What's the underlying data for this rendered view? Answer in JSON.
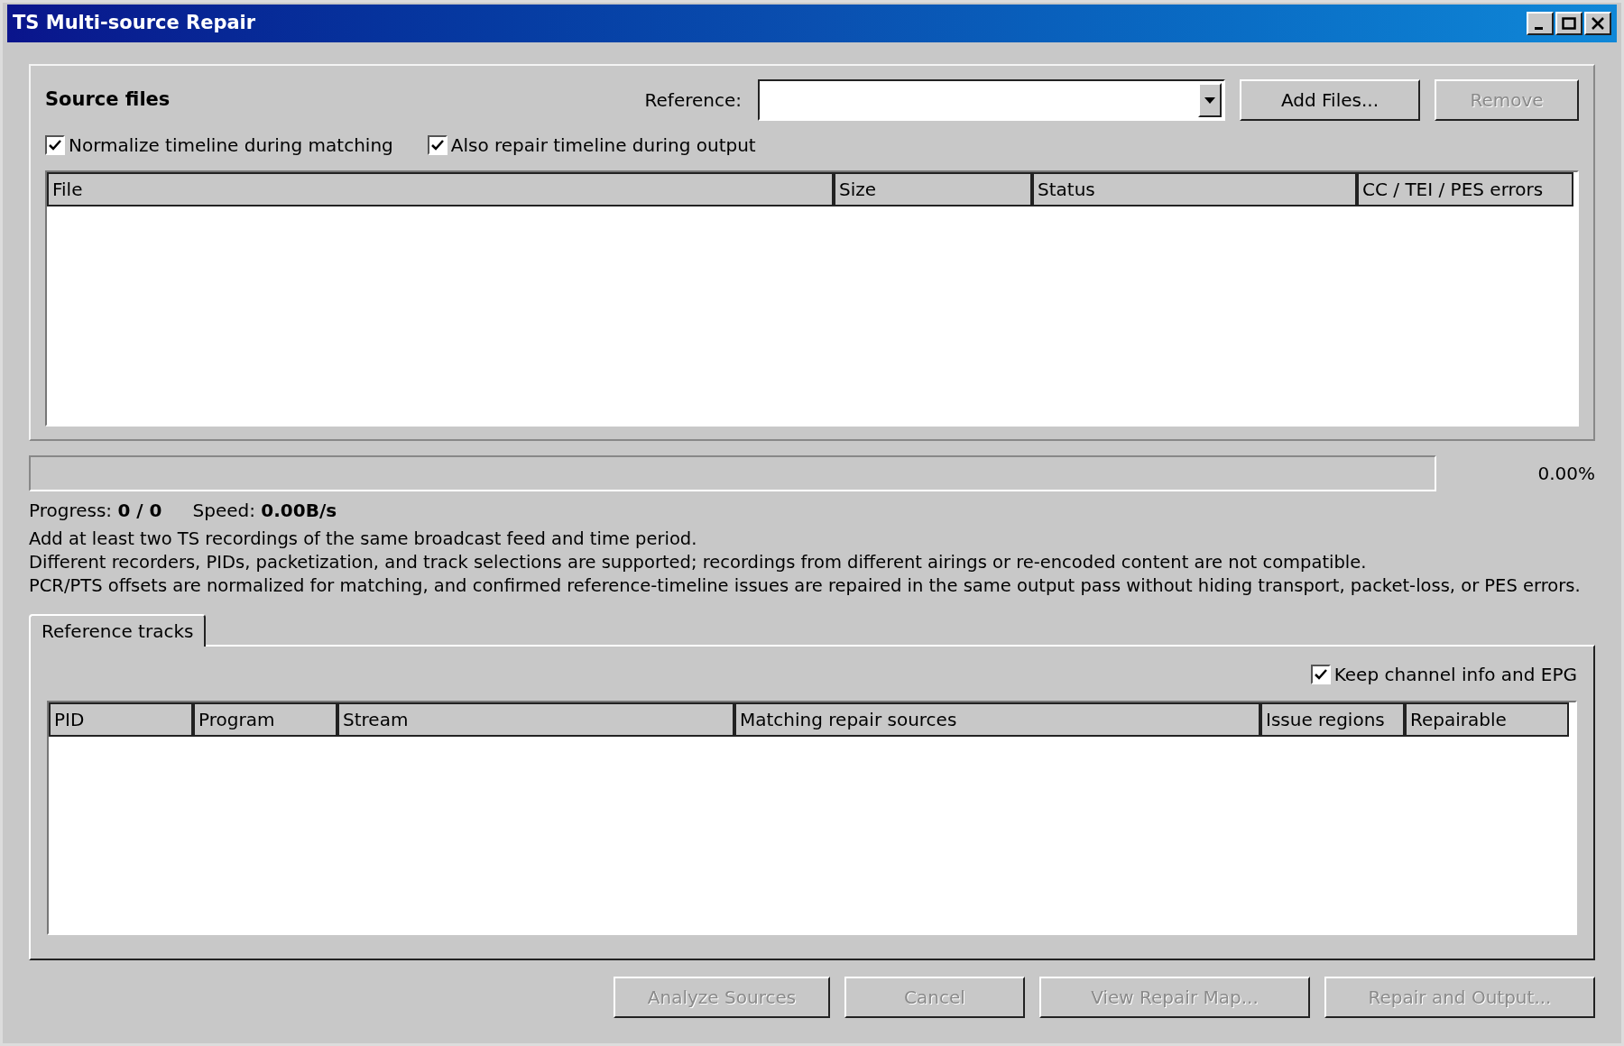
{
  "window": {
    "title": "TS Multi-source Repair"
  },
  "source_files": {
    "title": "Source files",
    "reference": {
      "label": "Reference:"
    },
    "buttons": [
      {
        "label": "Add Files...",
        "disabled": false
      },
      {
        "label": "Remove",
        "disabled": true
      }
    ],
    "checkboxes": [
      {
        "label": "Normalize timeline during matching",
        "checked": true
      },
      {
        "label": "Also repair timeline during output",
        "checked": true
      }
    ],
    "table": {
      "columns": [
        "File",
        "Size",
        "Status",
        "CC / TEI / PES errors"
      ]
    }
  },
  "progress": {
    "level": 0,
    "percent": "0.00%",
    "progress_label": "Progress:",
    "progress_value": "0 / 0",
    "speed_label": "Speed:",
    "speed_value": "0.00B/s"
  },
  "notes": [
    "Add at least two TS recordings of the same broadcast feed and time period.",
    "Different recorders, PIDs, packetization, and track selections are supported; recordings from different airings or re-encoded content are not compatible.",
    "PCR/PTS offsets are normalized for matching, and confirmed reference-timeline issues are repaired in the same output pass without hiding transport, packet-loss, or PES errors."
  ],
  "tabs": [
    {
      "label": "Reference tracks",
      "selected": true
    }
  ],
  "tracks": {
    "checkbox": {
      "label": "Keep channel info and EPG",
      "checked": true
    },
    "table": {
      "columns": [
        "PID",
        "Program",
        "Stream",
        "Matching repair sources",
        "Issue regions",
        "Repairable"
      ]
    }
  },
  "buttons": [
    {
      "label": "Analyze Sources",
      "disabled": true
    },
    {
      "label": "Cancel",
      "disabled": true
    },
    {
      "label": "View Repair Map...",
      "disabled": true
    },
    {
      "label": "Repair and Output...",
      "disabled": true
    }
  ]
}
